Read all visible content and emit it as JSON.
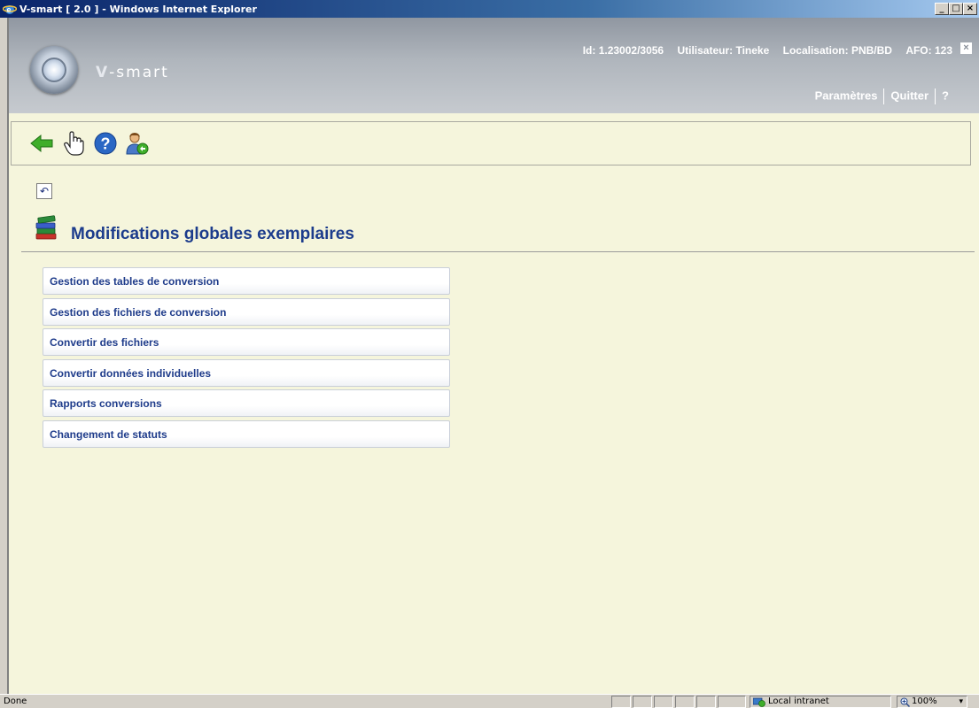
{
  "window": {
    "title": "V-smart [ 2.0 ] - Windows Internet Explorer",
    "min_label": "_",
    "max_label": "□",
    "close_label": "×"
  },
  "header": {
    "brand": "V-smart",
    "brand_v": "V",
    "brand_rest": "-smart",
    "id_text": "Id: 1.23002/3056",
    "user_text": "Utilisateur: Tineke",
    "location_text": "Localisation: PNB/BD",
    "afo_text": "AFO: 123",
    "close_label": "×",
    "links": {
      "settings": "Paramètres",
      "quit": "Quitter",
      "help": "?"
    }
  },
  "toolbar": {
    "icons": [
      "back-arrow-icon",
      "hand-pointer-icon",
      "help-icon",
      "user-switch-icon"
    ]
  },
  "page": {
    "undo_label": "↶",
    "title": "Modifications globales exemplaires"
  },
  "menu": {
    "items": [
      "Gestion des tables de conversion",
      "Gestion des fichiers de conversion",
      "Convertir des fichiers",
      "Convertir données individuelles",
      "Rapports conversions",
      "Changement de statuts"
    ]
  },
  "statusbar": {
    "status": "Done",
    "zone": "Local intranet",
    "zoom": "100%",
    "zoom_arrow": "▾"
  },
  "colors": {
    "accent": "#1c3c8c",
    "background": "#f5f5dc",
    "header": "#9097a1"
  }
}
